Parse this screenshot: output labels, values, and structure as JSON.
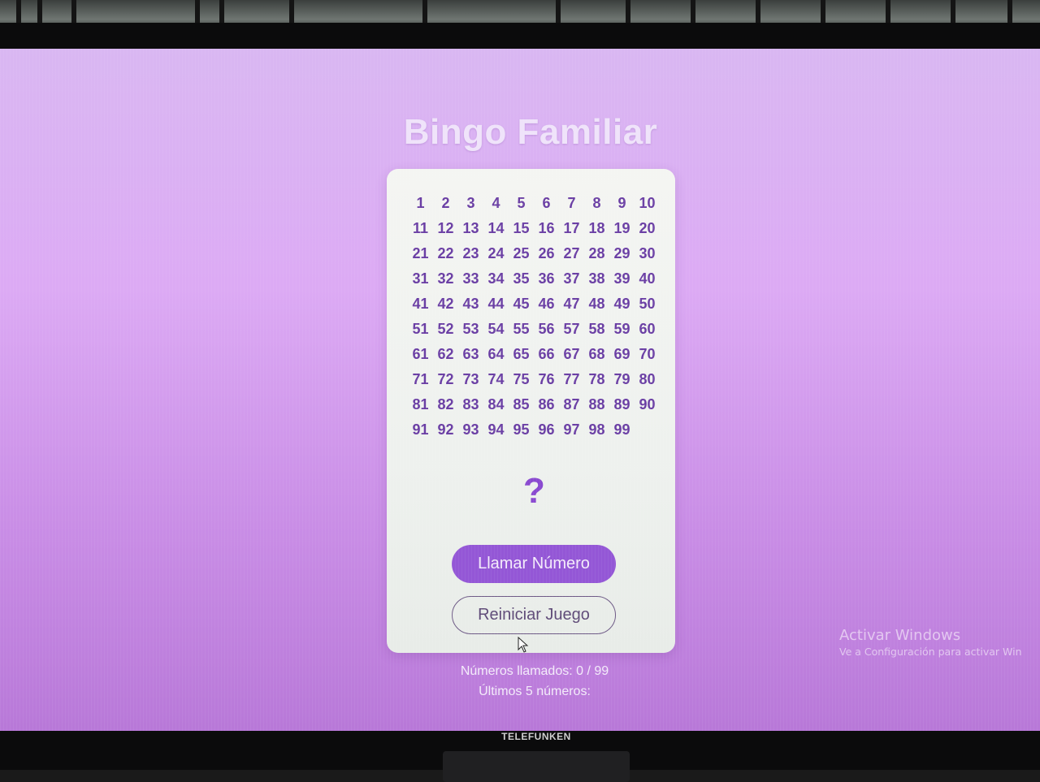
{
  "app": {
    "title": "Bingo Familiar"
  },
  "board": {
    "numbers": [
      1,
      2,
      3,
      4,
      5,
      6,
      7,
      8,
      9,
      10,
      11,
      12,
      13,
      14,
      15,
      16,
      17,
      18,
      19,
      20,
      21,
      22,
      23,
      24,
      25,
      26,
      27,
      28,
      29,
      30,
      31,
      32,
      33,
      34,
      35,
      36,
      37,
      38,
      39,
      40,
      41,
      42,
      43,
      44,
      45,
      46,
      47,
      48,
      49,
      50,
      51,
      52,
      53,
      54,
      55,
      56,
      57,
      58,
      59,
      60,
      61,
      62,
      63,
      64,
      65,
      66,
      67,
      68,
      69,
      70,
      71,
      72,
      73,
      74,
      75,
      76,
      77,
      78,
      79,
      80,
      81,
      82,
      83,
      84,
      85,
      86,
      87,
      88,
      89,
      90,
      91,
      92,
      93,
      94,
      95,
      96,
      97,
      98,
      99
    ],
    "current_number": "?"
  },
  "buttons": {
    "call_label": "Llamar Número",
    "reset_label": "Reiniciar Juego"
  },
  "status": {
    "called_text": "Números llamados: 0 / 99",
    "last_five_text": "Últimos 5 números:"
  },
  "watermark": {
    "line1": "Activar Windows",
    "line2": "Ve a Configuración para activar Win"
  },
  "tv": {
    "brand": "TELEFUNKEN"
  },
  "colors": {
    "background": "#dcaaf4",
    "card": "#f1f3f0",
    "accent": "#9457d6",
    "number_text": "#6a3ea4"
  }
}
